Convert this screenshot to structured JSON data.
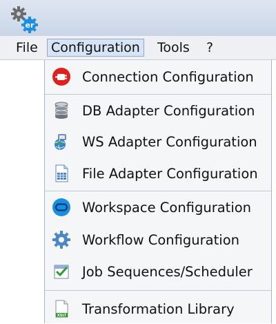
{
  "app": {
    "icon": "er-app-gear-icon"
  },
  "menubar": {
    "items": [
      {
        "label": "File"
      },
      {
        "label": "Configuration"
      },
      {
        "label": "Tools"
      },
      {
        "label": "?"
      }
    ],
    "active_index": 1
  },
  "dropdown": {
    "groups": [
      [
        {
          "label": "Connection Configuration",
          "icon": "power-plug-icon"
        }
      ],
      [
        {
          "label": "DB Adapter Configuration",
          "icon": "database-icon"
        },
        {
          "label": "WS Adapter Configuration",
          "icon": "web-service-globe-icon"
        },
        {
          "label": "File Adapter Configuration",
          "icon": "spreadsheet-file-icon"
        }
      ],
      [
        {
          "label": "Workspace Configuration",
          "icon": "workspace-icon"
        },
        {
          "label": "Workflow Configuration",
          "icon": "gear-icon"
        },
        {
          "label": "Job Sequences/Scheduler",
          "icon": "checklist-calendar-icon"
        }
      ],
      [
        {
          "label": "Transformation Library",
          "icon": "xslt-file-icon"
        }
      ]
    ]
  },
  "icon_badges": {
    "app": "er",
    "xslt": "XSLT"
  },
  "colors": {
    "titlebar": "#c9d5e7",
    "menu_active": "#d7e4f5",
    "menu_active_border": "#8fa9cc",
    "dropdown_bg": "#f5f6f8",
    "plug_red": "#e02020",
    "workspace_blue": "#1a8fe0",
    "gear_blue": "#4f86c6",
    "xslt_green": "#2f9a2f"
  }
}
